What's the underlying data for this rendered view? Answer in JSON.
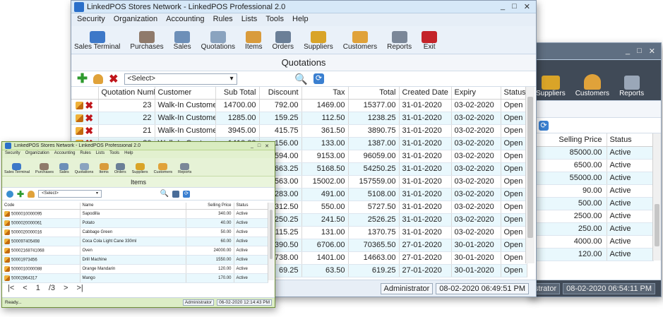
{
  "main": {
    "title": "LinkedPOS Stores Network - LinkedPOS Professional 2.0",
    "window_buttons": [
      "_",
      "□",
      "✕"
    ],
    "menu": [
      "Security",
      "Organization",
      "Accounting",
      "Rules",
      "Lists",
      "Tools",
      "Help"
    ],
    "toolbar": [
      {
        "label": "Sales Terminal",
        "icon": "computer-icon",
        "color": "#3d78c8"
      },
      {
        "label": "Purchases",
        "icon": "purchases-icon",
        "color": "#8f7a6b"
      },
      {
        "label": "Sales",
        "icon": "document-icon",
        "color": "#6d8fb8"
      },
      {
        "label": "Quotations",
        "icon": "calculator-icon",
        "color": "#8aa3bf"
      },
      {
        "label": "Items",
        "icon": "box-icon",
        "color": "#d99b3c"
      },
      {
        "label": "Orders",
        "icon": "cart-icon",
        "color": "#6b7f97"
      },
      {
        "label": "Suppliers",
        "icon": "truck-icon",
        "color": "#d9a428"
      },
      {
        "label": "Customers",
        "icon": "people-icon",
        "color": "#e0a23a"
      },
      {
        "label": "Reports",
        "icon": "reports-icon",
        "color": "#7b8798"
      },
      {
        "label": "Exit",
        "icon": "exit-icon",
        "color": "#c4242a"
      }
    ],
    "section_title": "Quotations",
    "select_value": "<Select>",
    "columns": [
      "Quotation Number",
      "Customer",
      "Sub Total",
      "Discount",
      "Tax",
      "Total",
      "Created Date",
      "Expiry",
      "Status"
    ],
    "rows": [
      [
        "23",
        "Walk-In Customer",
        "14700.00",
        "792.00",
        "1469.00",
        "15377.00",
        "31-01-2020",
        "03-02-2020",
        "Open"
      ],
      [
        "22",
        "Walk-In Customer",
        "1285.00",
        "159.25",
        "112.50",
        "1238.25",
        "31-01-2020",
        "03-02-2020",
        "Open"
      ],
      [
        "21",
        "Walk-In Customer",
        "3945.00",
        "415.75",
        "361.50",
        "3890.75",
        "31-01-2020",
        "03-02-2020",
        "Open"
      ],
      [
        "20",
        "Walk-In Customer",
        "1410.00",
        "156.00",
        "133.00",
        "1387.00",
        "31-01-2020",
        "03-02-2020",
        "Open"
      ],
      [
        "",
        "",
        "",
        "4594.00",
        "9153.00",
        "96059.00",
        "31-01-2020",
        "03-02-2020",
        "Open"
      ],
      [
        "",
        "",
        "",
        "2663.25",
        "5168.50",
        "54250.25",
        "31-01-2020",
        "03-02-2020",
        "Open"
      ],
      [
        "",
        "",
        "",
        "7563.00",
        "15002.00",
        "157559.00",
        "31-01-2020",
        "03-02-2020",
        "Open"
      ],
      [
        "",
        "",
        "",
        "283.00",
        "491.00",
        "5108.00",
        "31-01-2020",
        "03-02-2020",
        "Open"
      ],
      [
        "",
        "",
        "",
        "312.50",
        "550.00",
        "5727.50",
        "31-01-2020",
        "03-02-2020",
        "Open"
      ],
      [
        "",
        "",
        "",
        "250.25",
        "241.50",
        "2526.25",
        "31-01-2020",
        "03-02-2020",
        "Open"
      ],
      [
        "",
        "",
        "",
        "115.25",
        "131.00",
        "1370.75",
        "31-01-2020",
        "03-02-2020",
        "Open"
      ],
      [
        "",
        "",
        "",
        "3390.50",
        "6706.00",
        "70365.50",
        "27-01-2020",
        "30-01-2020",
        "Open"
      ],
      [
        "",
        "",
        "",
        "738.00",
        "1401.00",
        "14663.00",
        "27-01-2020",
        "30-01-2020",
        "Open"
      ],
      [
        "",
        "",
        "",
        "69.25",
        "63.50",
        "619.25",
        "27-01-2020",
        "30-01-2020",
        "Open"
      ]
    ],
    "status_user": "Administrator",
    "status_time": "08-02-2020 06:49:51 PM"
  },
  "back": {
    "window_buttons": [
      "_",
      "□",
      "✕"
    ],
    "toolbar": [
      {
        "label": "Suppliers",
        "icon": "truck-icon",
        "color": "#d9a428"
      },
      {
        "label": "Customers",
        "icon": "people-icon",
        "color": "#e0a23a"
      },
      {
        "label": "Reports",
        "icon": "reports-icon",
        "color": "#7b8798"
      }
    ],
    "columns": [
      "Selling Price",
      "Status"
    ],
    "rows": [
      [
        "85000.00",
        "Active"
      ],
      [
        "6500.00",
        "Active"
      ],
      [
        "55000.00",
        "Active"
      ],
      [
        "90.00",
        "Active"
      ],
      [
        "500.00",
        "Active"
      ],
      [
        "2500.00",
        "Active"
      ],
      [
        "250.00",
        "Active"
      ],
      [
        "4000.00",
        "Active"
      ],
      [
        "120.00",
        "Active"
      ]
    ],
    "status_user": "Administrator",
    "status_time": "08-02-2020 06:54:11 PM"
  },
  "items": {
    "title": "LinkedPOS Stores Network - LinkedPOS Professional 2.0",
    "window_buttons": [
      "_",
      "□",
      "✕"
    ],
    "menu": [
      "Security",
      "Organization",
      "Accounting",
      "Rules",
      "Lists",
      "Tools",
      "Help"
    ],
    "toolbar": [
      {
        "label": "Sales Terminal",
        "icon": "computer-icon",
        "color": "#3d78c8"
      },
      {
        "label": "Purchases",
        "icon": "purchases-icon",
        "color": "#8f7a6b"
      },
      {
        "label": "Sales",
        "icon": "document-icon",
        "color": "#6d8fb8"
      },
      {
        "label": "Quotations",
        "icon": "calculator-icon",
        "color": "#8aa3bf"
      },
      {
        "label": "Items",
        "icon": "box-icon",
        "color": "#d99b3c"
      },
      {
        "label": "Orders",
        "icon": "cart-icon",
        "color": "#6b7f97"
      },
      {
        "label": "Suppliers",
        "icon": "truck-icon",
        "color": "#d9a428"
      },
      {
        "label": "Customers",
        "icon": "people-icon",
        "color": "#e0a23a"
      },
      {
        "label": "Reports",
        "icon": "reports-icon",
        "color": "#7b8798"
      }
    ],
    "section_title": "Items",
    "select_value": "<Select>",
    "columns": [
      "Code",
      "Name",
      "Selling Price",
      "Status"
    ],
    "rows": [
      [
        "5000010000095",
        "Sapodilla",
        "340.00",
        "Active"
      ],
      [
        "5000020000061",
        "Potato",
        "40.00",
        "Active"
      ],
      [
        "5000020000016",
        "Cabbage Green",
        "50.00",
        "Active"
      ],
      [
        "500097405498",
        "Coca Cola Light Cane 330ml",
        "60.00",
        "Active"
      ],
      [
        "50002168741068",
        "Oven",
        "24000.00",
        "Active"
      ],
      [
        "50001973456",
        "Drill Machine",
        "1550.00",
        "Active"
      ],
      [
        "5000010000088",
        "Orange Mandarin",
        "120.00",
        "Active"
      ],
      [
        "50002864317",
        "Mango",
        "170.00",
        "Active"
      ]
    ],
    "pager": {
      "first": "|<",
      "prev": "<",
      "page": "1",
      "of": "/3",
      "next": ">",
      "last": ">|"
    },
    "status_ready": "Ready...",
    "status_user": "Administrator",
    "status_time": "06-02-2020 12:14:43 PM"
  }
}
